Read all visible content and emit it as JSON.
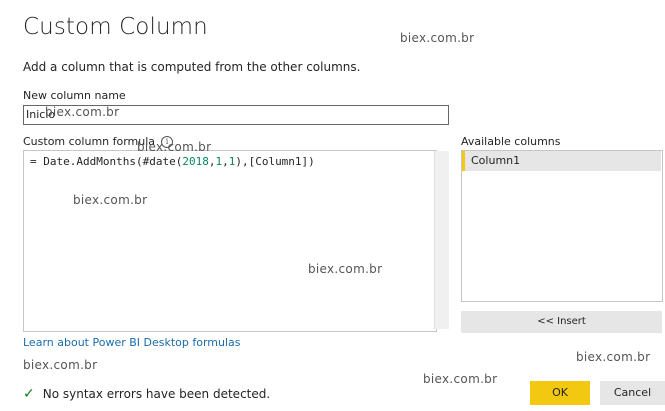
{
  "dialog": {
    "title": "Custom Column",
    "subtitle": "Add a column that is computed from the other columns."
  },
  "new_column": {
    "label": "New column name",
    "value": "Inicio"
  },
  "formula": {
    "label": "Custom column formula",
    "info_icon": "i",
    "part1": "= Date.AddMonths(#date(",
    "n1": "2018",
    "c1": ",",
    "n2": "1",
    "c2": ",",
    "n3": "1",
    "part2": "),[Column1])"
  },
  "available": {
    "label": "Available columns",
    "items": [
      "Column1"
    ],
    "insert_label": "<< Insert"
  },
  "learn_link": "Learn about Power BI Desktop formulas",
  "status": {
    "icon": "check-icon",
    "text": "No syntax errors have been detected."
  },
  "buttons": {
    "ok": "OK",
    "cancel": "Cancel"
  },
  "watermarks": [
    "biex.com.br",
    "biex.com.br",
    "biex.com.br",
    "biex.com.br",
    "biex.com.br",
    "biex.com.br",
    "biex.com.br",
    "biex.com.br"
  ],
  "colors": {
    "accent": "#f2c811",
    "link": "#1a6dac",
    "success": "#107c10"
  }
}
